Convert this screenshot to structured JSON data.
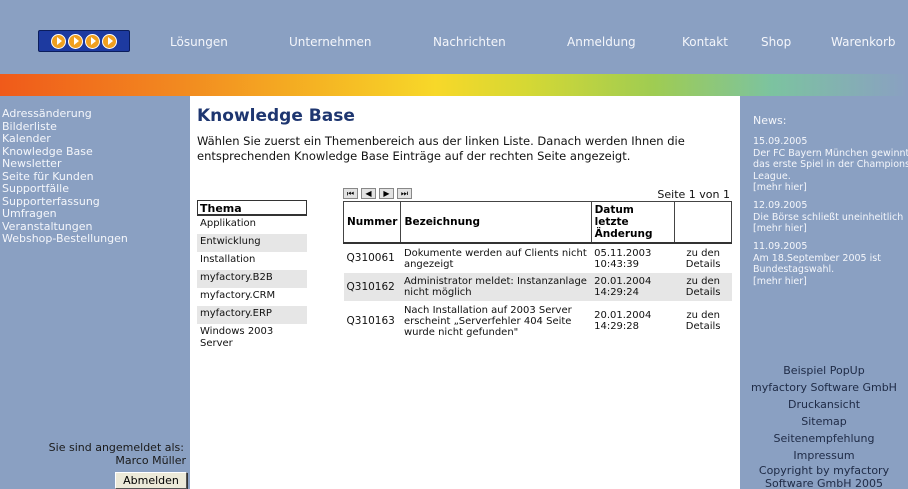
{
  "nav": {
    "items": [
      "Lösungen",
      "Unternehmen",
      "Nachrichten",
      "Anmeldung",
      "Kontakt",
      "Shop",
      "Warenkorb"
    ]
  },
  "sidebar": {
    "links": [
      "Adressänderung",
      "Bilderliste",
      "Kalender",
      "Knowledge Base",
      "Newsletter",
      "Seite für Kunden",
      "Supportfälle",
      "Supporterfassung",
      "Umfragen",
      "Veranstaltungen",
      "Webshop-Bestellungen"
    ],
    "login_label": "Sie sind angemeldet als:",
    "login_user": "Marco Müller",
    "logout_label": "Abmelden"
  },
  "main": {
    "title": "Knowledge Base",
    "intro": "Wählen Sie zuerst ein Themenbereich aus der linken Liste. Danach werden Ihnen die entsprechenden Knowledge Base Einträge auf der rechten Seite angezeigt.",
    "thema_header": "Thema",
    "themes": [
      "Applikation",
      "Entwicklung",
      "Installation",
      "myfactory.B2B",
      "myfactory.CRM",
      "myfactory.ERP",
      "Windows 2003 Server"
    ],
    "pager": {
      "first": "⏮",
      "prev": "◀",
      "next": "▶",
      "last": "⏭",
      "label": "Seite 1 von 1"
    },
    "table": {
      "headers": [
        "Nummer",
        "Bezeichnung",
        "Datum letzte Änderung",
        ""
      ],
      "rows": [
        {
          "nummer": "Q310061",
          "bezeichnung": "Dokumente werden auf Clients nicht angezeigt",
          "datum": "05.11.2003",
          "zeit": "10:43:39",
          "details": "zu den Details"
        },
        {
          "nummer": "Q310162",
          "bezeichnung": "Administrator meldet: Instanzanlage nicht möglich",
          "datum": "20.01.2004",
          "zeit": "14:29:24",
          "details": "zu den Details"
        },
        {
          "nummer": "Q310163",
          "bezeichnung": "Nach Installation auf 2003 Server erscheint „Serverfehler 404 Seite wurde nicht gefunden\"",
          "datum": "20.01.2004",
          "zeit": "14:29:28",
          "details": "zu den Details"
        }
      ]
    }
  },
  "news": {
    "title": "News:",
    "items": [
      {
        "date": "15.09.2005",
        "text": "Der FC Bayern München gewinnt das erste Spiel in der Champions League.",
        "more": "[mehr hier]"
      },
      {
        "date": "12.09.2005",
        "text": "Die Börse schließt uneinheitlich",
        "more": "[mehr hier]"
      },
      {
        "date": "11.09.2005",
        "text": "Am 18.September 2005 ist Bundestagswahl.",
        "more": "[mehr hier]"
      }
    ]
  },
  "footer": {
    "links": [
      "Beispiel PopUp",
      "myfactory Software GmbH",
      "Druckansicht",
      "Sitemap",
      "Seitenempfehlung",
      "Impressum",
      "Copyright by myfactory Software GmbH 2005"
    ]
  },
  "colors": {
    "frame": "#8aa0c2",
    "title": "#1e3670",
    "logo_bg": "#1d3aa0",
    "logo_dot": "#f0a020"
  }
}
